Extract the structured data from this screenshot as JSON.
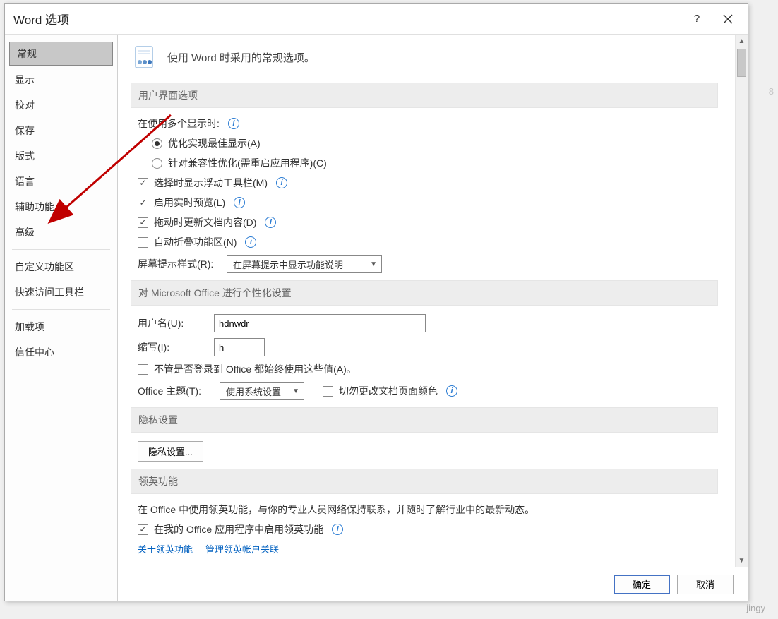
{
  "dialog": {
    "title": "Word 选项"
  },
  "sidebar": {
    "items": [
      {
        "label": "常规",
        "selected": true
      },
      {
        "label": "显示"
      },
      {
        "label": "校对"
      },
      {
        "label": "保存"
      },
      {
        "label": "版式"
      },
      {
        "label": "语言"
      },
      {
        "label": "辅助功能"
      },
      {
        "label": "高级"
      }
    ],
    "items2": [
      {
        "label": "自定义功能区"
      },
      {
        "label": "快速访问工具栏"
      }
    ],
    "items3": [
      {
        "label": "加载项"
      },
      {
        "label": "信任中心"
      }
    ]
  },
  "main": {
    "heading": "使用 Word 时采用的常规选项。",
    "sections": {
      "ui": {
        "title": "用户界面选项",
        "multi_display_label": "在使用多个显示时:",
        "radio1": "优化实现最佳显示(A)",
        "radio2": "针对兼容性优化(需重启应用程序)(C)",
        "check1": "选择时显示浮动工具栏(M)",
        "check2": "启用实时预览(L)",
        "check3": "拖动时更新文档内容(D)",
        "check4": "自动折叠功能区(N)",
        "screentip_label": "屏幕提示样式(R):",
        "screentip_value": "在屏幕提示中显示功能说明"
      },
      "personalize": {
        "title": "对 Microsoft Office 进行个性化设置",
        "username_label": "用户名(U):",
        "username_value": "hdnwdr",
        "initials_label": "缩写(I):",
        "initials_value": "h",
        "always_use": "不管是否登录到 Office 都始终使用这些值(A)。",
        "theme_label": "Office 主题(T):",
        "theme_value": "使用系统设置",
        "keep_page_color": "切勿更改文档页面颜色"
      },
      "privacy": {
        "title": "隐私设置",
        "button": "隐私设置..."
      },
      "linkedin": {
        "title": "领英功能",
        "desc": "在 Office 中使用领英功能，与你的专业人员网络保持联系，并随时了解行业中的最新动态。",
        "check": "在我的 Office 应用程序中启用领英功能",
        "link1": "关于领英功能",
        "link2": "管理领英帐户关联"
      }
    }
  },
  "footer": {
    "ok": "确定",
    "cancel": "取消"
  },
  "ghost": "8",
  "watermark": "jingy"
}
